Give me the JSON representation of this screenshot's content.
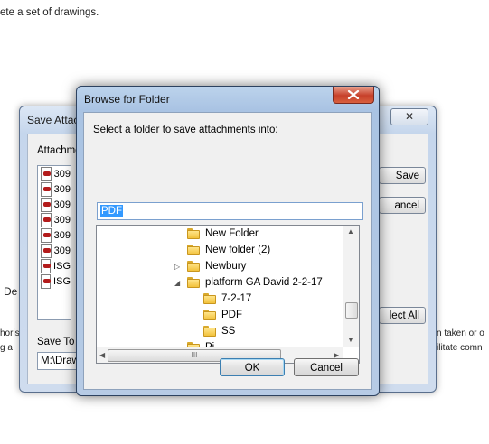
{
  "document": {
    "line1": "ete a set of drawings.",
    "left_fragment_de": "De",
    "left_fragment_horis": "horis",
    "left_fragment_ga": "g a",
    "right_fragment_1": "n taken or o",
    "right_fragment_2": "ilitate comn"
  },
  "save_dialog": {
    "title": "Save Attac",
    "close_label": "✕",
    "attachments_label": "Attachme",
    "attachments": [
      "309",
      "309",
      "309",
      "309",
      "309",
      "309",
      "ISG",
      "ISG"
    ],
    "save_button": "Save",
    "cancel_button": "ancel",
    "select_all_button": "lect All",
    "save_to_label": "Save To",
    "save_to_path": "M:\\Draw"
  },
  "browse_dialog": {
    "title": "Browse for Folder",
    "prompt": "Select a folder to save attachments into:",
    "folder_value": "PDF",
    "tree": [
      {
        "label": "New Folder",
        "expander": ""
      },
      {
        "label": "New folder (2)",
        "expander": ""
      },
      {
        "label": "Newbury",
        "expander": "▷"
      },
      {
        "label": "platform GA David 2-2-17",
        "expander": "◢"
      },
      {
        "label": "7-2-17",
        "expander": ""
      },
      {
        "label": "PDF",
        "expander": ""
      },
      {
        "label": "SS",
        "expander": ""
      },
      {
        "label": "Pi",
        "expander": ""
      }
    ],
    "hscroll_grip": "III",
    "ok_button": "OK",
    "cancel_button": "Cancel"
  }
}
